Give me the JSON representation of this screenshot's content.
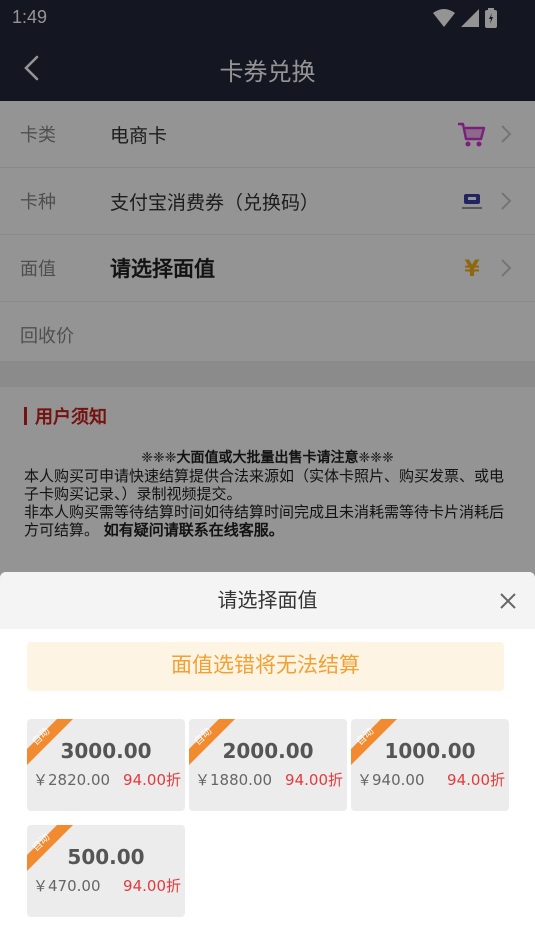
{
  "status_bar": {
    "time": "1:49"
  },
  "header": {
    "title": "卡券兑换"
  },
  "form": {
    "rows": [
      {
        "label": "卡类",
        "value": "电商卡",
        "icon": "cart-icon"
      },
      {
        "label": "卡种",
        "value": "支付宝消费券（兑换码）",
        "icon": "card-icon"
      },
      {
        "label": "面值",
        "value": "请选择面值",
        "icon": "yen-icon"
      },
      {
        "label": "回收价",
        "value": ""
      }
    ]
  },
  "notice": {
    "heading": "用户须知",
    "warning": "❈❈❈大面值或大批量出售卡请注意❈❈❈",
    "line1": "本人购买可申请快速结算提供合法来源如（实体卡照片、购买发票、或电子卡购买记录、）录制视频提交。",
    "line2": "非本人购买需等待结算时间如待结算时间完成且未消耗需等待卡片消耗后方可结算。",
    "line2_bold": "如有疑问请联系在线客服。"
  },
  "sheet": {
    "title": "请选择面值",
    "tip": "面值选错将无法结算",
    "cards": [
      {
        "tag": "自动",
        "amount": "3000.00",
        "price": "￥2820.00",
        "discount": "94.00折"
      },
      {
        "tag": "自动",
        "amount": "2000.00",
        "price": "￥1880.00",
        "discount": "94.00折"
      },
      {
        "tag": "自动",
        "amount": "1000.00",
        "price": "￥940.00",
        "discount": "94.00折"
      },
      {
        "tag": "自动",
        "amount": "500.00",
        "price": "￥470.00",
        "discount": "94.00折"
      }
    ]
  },
  "colors": {
    "header_bg": "#23273a",
    "accent_red": "#e5393b",
    "tag_orange": "#f28a30",
    "tip_text": "#f3a033"
  }
}
